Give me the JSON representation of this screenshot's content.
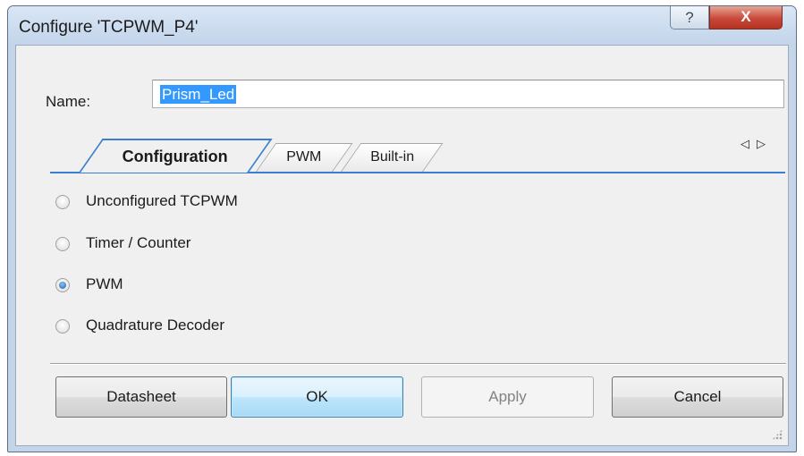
{
  "window": {
    "title": "Configure 'TCPWM_P4'",
    "help_glyph": "?",
    "close_glyph": "X"
  },
  "name_field": {
    "label": "Name:",
    "value": "Prism_Led"
  },
  "tabs": [
    {
      "label": "Configuration",
      "active": true
    },
    {
      "label": "PWM",
      "active": false
    },
    {
      "label": "Built-in",
      "active": false
    }
  ],
  "tab_scroll": {
    "left_glyph": "◁",
    "right_glyph": "▷"
  },
  "options": [
    {
      "label": "Unconfigured TCPWM",
      "checked": false
    },
    {
      "label": "Timer / Counter",
      "checked": false
    },
    {
      "label": "PWM",
      "checked": true
    },
    {
      "label": "Quadrature Decoder",
      "checked": false
    }
  ],
  "buttons": {
    "datasheet": "Datasheet",
    "ok": "OK",
    "apply": "Apply",
    "cancel": "Cancel"
  },
  "colors": {
    "accent": "#3c7fd0",
    "selection": "#3399ff",
    "close_button": "#c9483a"
  }
}
